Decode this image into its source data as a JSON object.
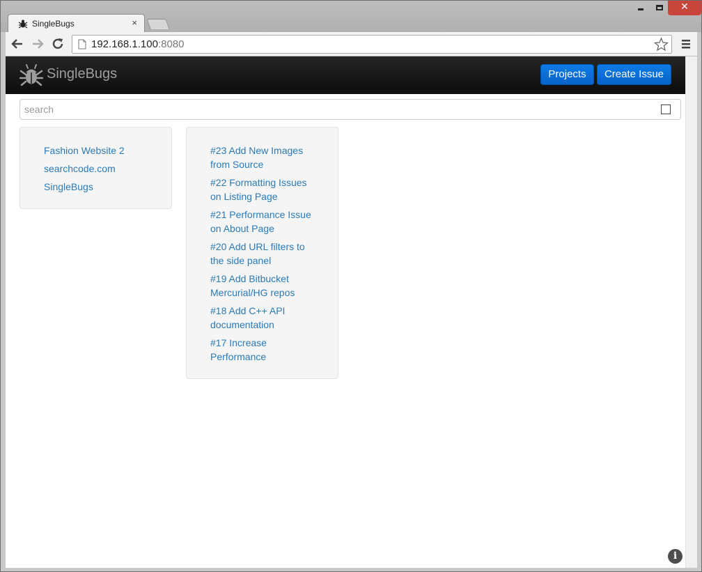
{
  "browser": {
    "tab_title": "SingleBugs",
    "tab_close": "×",
    "url_host": "192.168.1.100",
    "url_port": ":8080",
    "window_close": "✕"
  },
  "navbar": {
    "brand": "SingleBugs",
    "projects_label": "Projects",
    "create_issue_label": "Create Issue"
  },
  "search": {
    "placeholder": "search"
  },
  "projects": [
    "Fashion Website 2",
    "searchcode.com",
    "SingleBugs"
  ],
  "issues": [
    "#23 Add New Images from Source",
    "#22 Formatting Issues on Listing Page",
    "#21 Performance Issue on About Page",
    "#20 Add URL filters to the side panel",
    "#19 Add Bitbucket Mercurial/HG repos",
    "#18 Add C++ API documentation",
    "#17 Increase Performance"
  ],
  "info_glyph": "i",
  "colors": {
    "navbar": "#0d0d0d",
    "button": "#0863c9",
    "link": "#2a7ab8",
    "panel": "#f5f5f5"
  }
}
